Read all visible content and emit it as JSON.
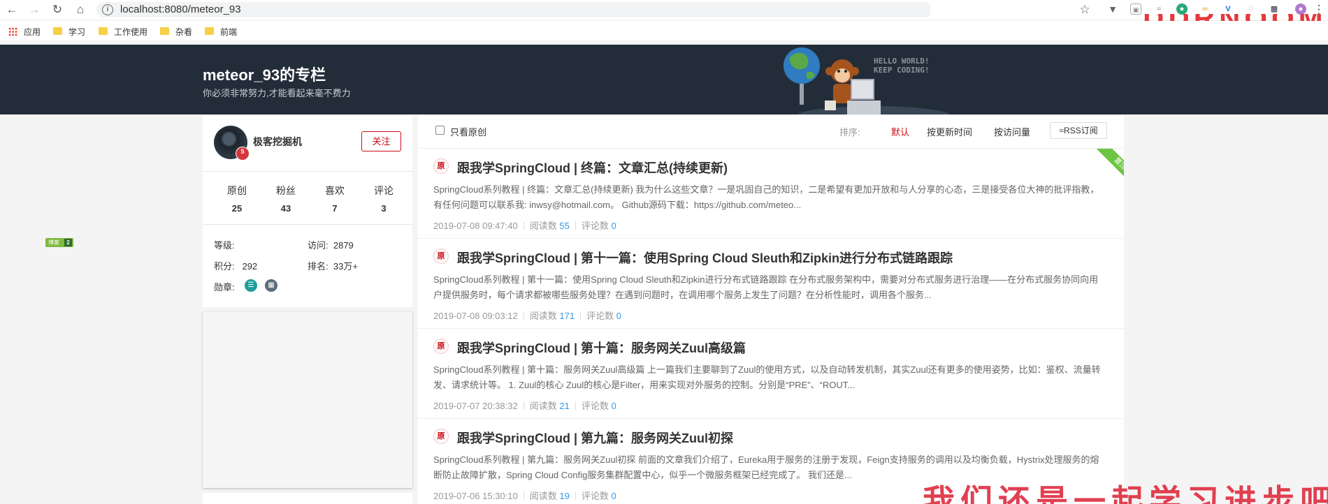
{
  "browser": {
    "url": "localhost:8080/meteor_93",
    "bookmarks": [
      "应用",
      "学习",
      "工作使用",
      "杂看",
      "前端"
    ]
  },
  "header": {
    "title": "meteor_93的专栏",
    "subtitle": "你必须非常努力,才能看起来毫不费力",
    "banner_text_1": "HELLO WORLD!",
    "banner_text_2": "KEEP CODING!"
  },
  "profile": {
    "name": "极客挖掘机",
    "avatar_level": "5",
    "follow_label": "关注",
    "stats": [
      {
        "label": "原创",
        "value": "25"
      },
      {
        "label": "粉丝",
        "value": "43"
      },
      {
        "label": "喜欢",
        "value": "7"
      },
      {
        "label": "评论",
        "value": "3"
      }
    ],
    "level_label": "等级:",
    "level_badge": "博客",
    "level_num": "2",
    "visits_label": "访问:",
    "visits": "2879",
    "points_label": "积分:",
    "points": "292",
    "rank_label": "排名:",
    "rank": "33万+",
    "medals_label": "勋章:"
  },
  "toolbar": {
    "only_original": "只看原创",
    "sort_label": "排序:",
    "sort_default": "默认",
    "sort_updated": "按更新时间",
    "sort_visits": "按访问量",
    "rss": "RSS订阅"
  },
  "top_tag": "置顶",
  "articles": [
    {
      "badge": "原",
      "title": "跟我学SpringCloud | 终篇：文章汇总(持续更新)",
      "desc": "SpringCloud系列教程 | 终篇：文章汇总(持续更新) 我为什么这些文章？一是巩固自己的知识，二是希望有更加开放和与人分享的心态，三是接受各位大神的批评指教，有任何问题可以联系我: inwsy@hotmail.com。 Github源码下载：https://github.com/meteo...",
      "date": "2019-07-08 09:47:40",
      "reads_label": "阅读数",
      "reads": "55",
      "comments_label": "评论数",
      "comments": "0"
    },
    {
      "badge": "原",
      "title": "跟我学SpringCloud | 第十一篇：使用Spring Cloud Sleuth和Zipkin进行分布式链路跟踪",
      "desc": "SpringCloud系列教程 | 第十一篇：使用Spring Cloud Sleuth和Zipkin进行分布式链路跟踪 在分布式服务架构中，需要对分布式服务进行治理——在分布式服务协同向用户提供服务时，每个请求都被哪些服务处理？在遇到问题时，在调用哪个服务上发生了问题？在分析性能时，调用各个服务...",
      "date": "2019-07-08 09:03:12",
      "reads_label": "阅读数",
      "reads": "171",
      "comments_label": "评论数",
      "comments": "0"
    },
    {
      "badge": "原",
      "title": "跟我学SpringCloud | 第十篇：服务网关Zuul高级篇",
      "desc": "SpringCloud系列教程 | 第十篇：服务网关Zuul高级篇 上一篇我们主要聊到了Zuul的使用方式，以及自动转发机制，其实Zuul还有更多的使用姿势，比如：鉴权、流量转发、请求统计等。 1. Zuul的核心 Zuul的核心是Filter，用来实现对外服务的控制。分别是“PRE”、“ROUT...",
      "date": "2019-07-07 20:38:32",
      "reads_label": "阅读数",
      "reads": "21",
      "comments_label": "评论数",
      "comments": "0"
    },
    {
      "badge": "原",
      "title": "跟我学SpringCloud | 第九篇：服务网关Zuul初探",
      "desc": "SpringCloud系列教程 | 第九篇：服务网关Zuul初探 前面的文章我们介绍了，Eureka用于服务的注册于发现，Feign支持服务的调用以及均衡负载，Hystrix处理服务的熔断防止故障扩散，Spring Cloud Config服务集群配置中心，似乎一个微服务框架已经完成了。 我们还是...",
      "date": "2019-07-06 15:30:10",
      "reads_label": "阅读数",
      "reads": "19",
      "comments_label": "评论数",
      "comments": "0"
    }
  ]
}
